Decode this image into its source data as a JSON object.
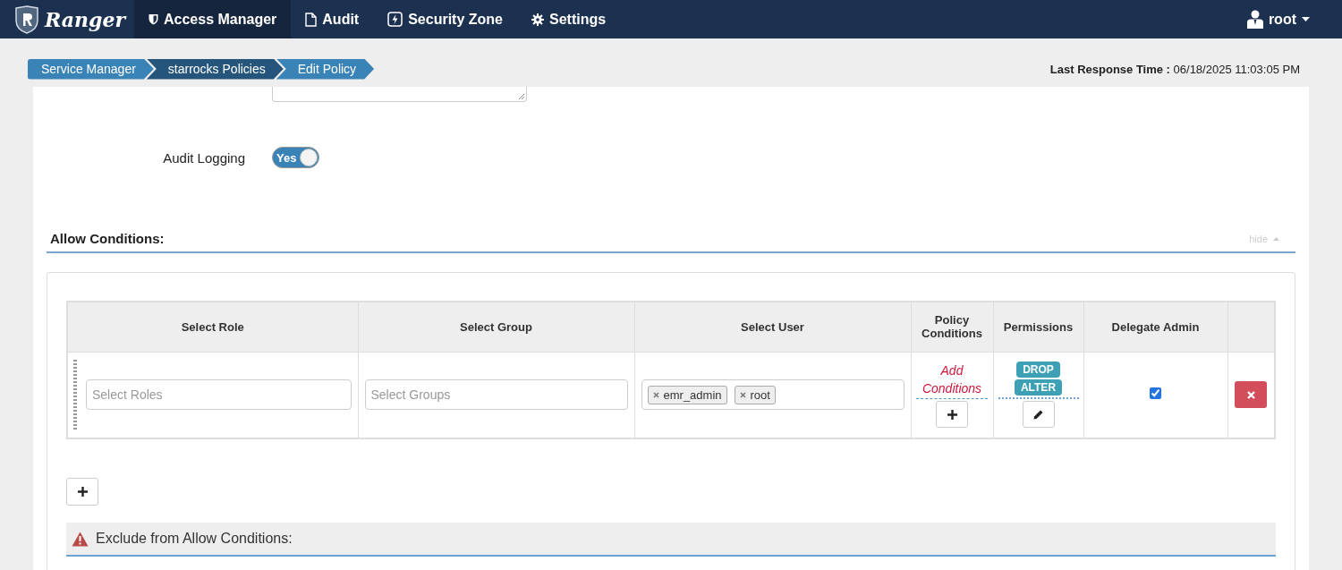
{
  "navbar": {
    "brand": "Ranger",
    "items": [
      {
        "label": "Access Manager",
        "selected": true
      },
      {
        "label": "Audit",
        "selected": false
      },
      {
        "label": "Security Zone",
        "selected": false
      },
      {
        "label": "Settings",
        "selected": false
      }
    ],
    "user": "root"
  },
  "breadcrumb": [
    {
      "label": "Service Manager",
      "selected": false
    },
    {
      "label": "starrocks Policies",
      "selected": true
    },
    {
      "label": "Edit Policy",
      "selected": false
    }
  ],
  "last_response": {
    "label": "Last Response Time :",
    "value": "06/18/2025 11:03:05 PM"
  },
  "audit_logging": {
    "label": "Audit Logging",
    "toggle_text": "Yes",
    "on": true
  },
  "allow_conditions": {
    "title": "Allow Conditions:",
    "hide_link": "hide",
    "columns": [
      "Select Role",
      "Select Group",
      "Select User",
      "Policy Conditions",
      "Permissions",
      "Delegate Admin"
    ],
    "rows": [
      {
        "roles_placeholder": "Select Roles",
        "groups_placeholder": "Select Groups",
        "users": [
          "emr_admin",
          "root"
        ],
        "add_conditions": "Add Conditions",
        "permissions": [
          "DROP",
          "ALTER"
        ],
        "delegate_admin": true
      }
    ]
  },
  "exclude": {
    "title": "Exclude from Allow Conditions:"
  }
}
